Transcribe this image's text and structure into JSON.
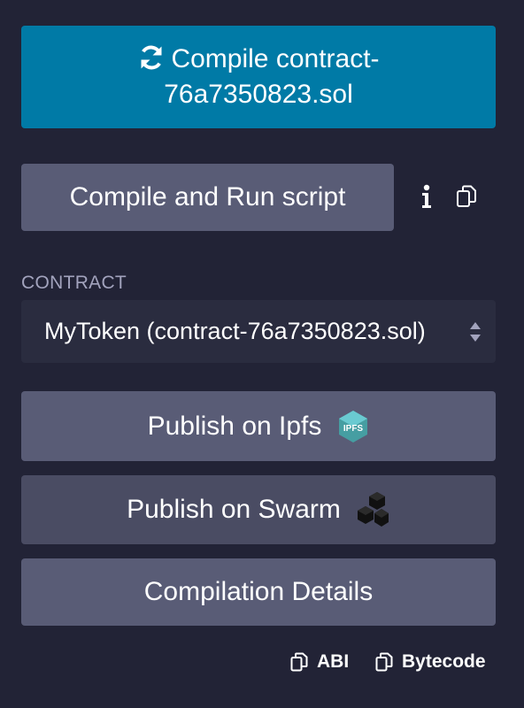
{
  "compile_button": {
    "line1": "Compile contract-",
    "line2": "76a7350823.sol",
    "icon": "refresh-icon",
    "color": "#007aa6"
  },
  "run_script_button": {
    "label": "Compile and Run script"
  },
  "toolbar_icons": [
    "info-icon",
    "copy-icon"
  ],
  "contract": {
    "label": "CONTRACT",
    "selected": "MyToken (contract-76a7350823.sol)"
  },
  "actions": {
    "ipfs_label": "Publish on Ipfs",
    "ipfs_icon_text": "IPFS",
    "swarm_label": "Publish on Swarm",
    "details_label": "Compilation Details"
  },
  "footer": {
    "abi_label": "ABI",
    "bytecode_label": "Bytecode"
  },
  "colors": {
    "background": "#222336",
    "button": "#595c76",
    "primary": "#007aa6",
    "ipfs": "#469ea2"
  }
}
